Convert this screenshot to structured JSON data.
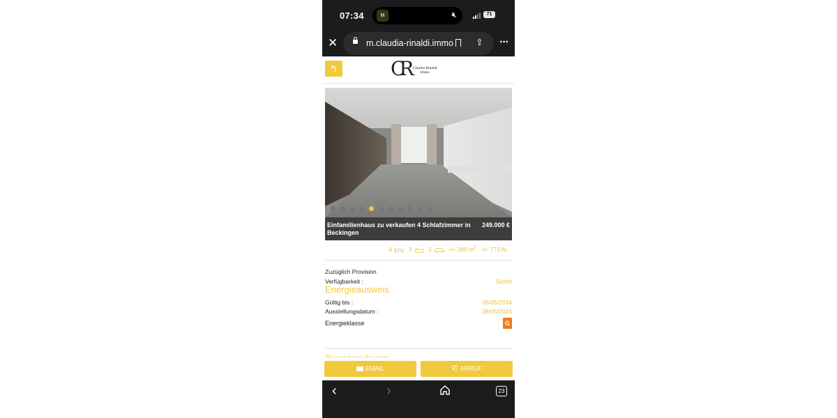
{
  "status_bar": {
    "time": "07:34",
    "app_badge": "M",
    "battery": "71"
  },
  "browser": {
    "url": "m.claudia-rinaldi.immo",
    "tab_count": "23"
  },
  "header": {
    "logo_mark": "CR",
    "logo_name_line1": "Claudia Rinaldi",
    "logo_name_line2": "Immo"
  },
  "listing": {
    "title": "Einfamilienhaus zu verkaufen 4 Schlafzimmer in Beckingen",
    "price": "249.000 €",
    "gallery": {
      "slide_count": 11,
      "active_index": 4
    },
    "features": {
      "bedrooms": "4",
      "bathrooms": "3",
      "parking": "3",
      "living_area": "+/- 260 m",
      "living_area_sup": "2",
      "land_area": "+/- 773 Ar"
    }
  },
  "details": {
    "commission": "Zuzüglich Provision",
    "availability_label": "Verfügbarkeit :",
    "availability_value": "Sofort",
    "energy_title": "Energieausweis",
    "valid_until_label": "Gültig bis :",
    "valid_until_value": "05/05/2034",
    "issue_date_label": "Ausstellungsdatum :",
    "issue_date_value": "06/05/2024",
    "energy_class_label": "Energieklasse",
    "energy_class_value": "G",
    "next_section": "Beschreibung"
  },
  "actions": {
    "email_label": "EMAIL",
    "call_label": "ANRUF"
  },
  "colors": {
    "accent": "#f0c93c",
    "energy_g": "#f07a1a",
    "chrome": "#1c1c1e"
  }
}
